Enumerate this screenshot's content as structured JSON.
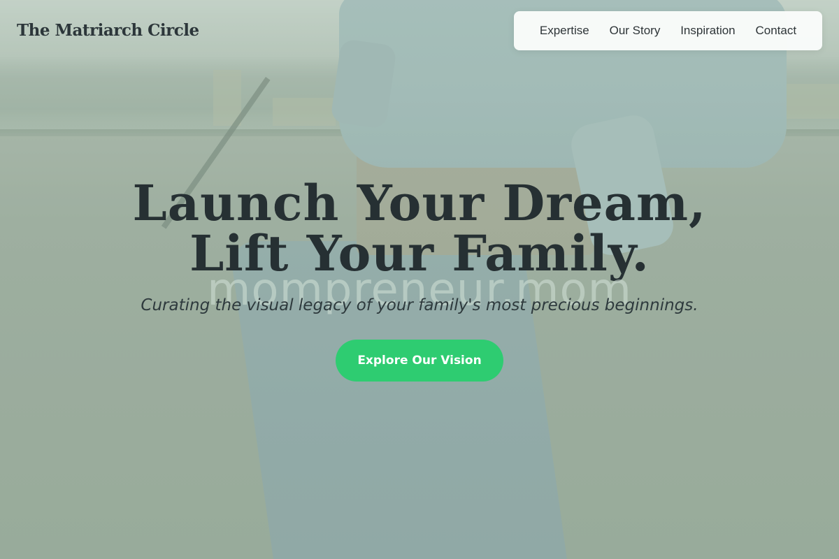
{
  "brand": {
    "logo_text": "The Matriarch Circle"
  },
  "nav": {
    "items": [
      {
        "label": "Expertise"
      },
      {
        "label": "Our Story"
      },
      {
        "label": "Inspiration"
      },
      {
        "label": "Contact"
      }
    ]
  },
  "hero": {
    "headline_line1": "Launch Your Dream,",
    "headline_line2": "Lift Your Family.",
    "watermark": "mompreneur.mom",
    "tagline": "Curating the visual legacy of your family's most precious beginnings.",
    "cta_label": "Explore Our Vision"
  },
  "colors": {
    "accent": "#2ecc71",
    "text_dark": "#263033",
    "nav_bg": "#fafcfb"
  }
}
